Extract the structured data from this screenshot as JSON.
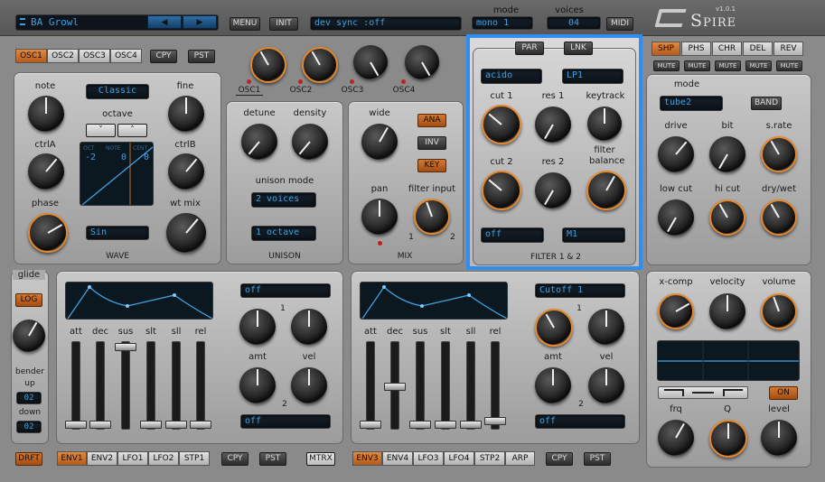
{
  "header": {
    "preset_name": "BA Growl",
    "prev_icon": "◀",
    "next_icon": "▶",
    "menu": "MENU",
    "init": "INIT",
    "fx_message": "dev sync :off",
    "mode_label": "mode",
    "mode_value": "mono 1",
    "voices_label": "voices",
    "voices_value": "04",
    "midi": "MIDI",
    "version": "v1.0.1",
    "logo": "Spire"
  },
  "osc": {
    "tabs": [
      "OSC1",
      "OSC2",
      "OSC3",
      "OSC4"
    ],
    "cpy": "CPY",
    "pst": "PST",
    "led_labels": [
      "OSC1",
      "OSC2",
      "OSC3",
      "OSC4"
    ],
    "note": "note",
    "fine": "fine",
    "wt_mode": "Classic",
    "octave": "octave",
    "oct_down": "˅",
    "oct_up": "˄",
    "ctrlA": "ctrlA",
    "ctrlB": "ctrlB",
    "phase": "phase",
    "wtmix": "wt mix",
    "readout_labels": [
      "OCT",
      "NOTE",
      "CENT"
    ],
    "readout_values": [
      "-2",
      "0",
      "0"
    ],
    "wave_select": "Sin",
    "wave_title": "WAVE"
  },
  "unison": {
    "detune": "detune",
    "density": "density",
    "mode_label": "unison mode",
    "mode_value": "2 voices",
    "octave_value": "1 octave",
    "title": "UNISON"
  },
  "mix": {
    "wide": "wide",
    "ana": "ANA",
    "inv": "INV",
    "key": "KEY",
    "pan": "pan",
    "filter_input": "filter input",
    "num1": "1",
    "num2": "2",
    "title": "MIX"
  },
  "filter": {
    "par": "PAR",
    "lnk": "LNK",
    "type1": "acido",
    "type2": "LP1",
    "cut1": "cut 1",
    "res1": "res 1",
    "keytrack": "keytrack",
    "cut2": "cut 2",
    "res2": "res 2",
    "balance": "filter balance",
    "mode1": "off",
    "mode2": "M1",
    "title": "FILTER 1 & 2",
    "highlight": "#2f8ef0"
  },
  "fx": {
    "tabs": [
      "SHP",
      "PHS",
      "CHR",
      "DEL",
      "REV"
    ],
    "mute": "MUTE",
    "mode_label": "mode",
    "mode_value": "tube2",
    "band": "BAND",
    "drive": "drive",
    "bit": "bit",
    "srate": "s.rate",
    "lowcut": "low cut",
    "hicut": "hi cut",
    "drywet": "dry/wet"
  },
  "master": {
    "xcomp": "x-comp",
    "velocity": "velocity",
    "volume": "volume",
    "on": "ON",
    "frq": "frq",
    "q": "Q",
    "level": "level"
  },
  "glide": {
    "title": "glide",
    "log": "LOG",
    "bender": "bender",
    "up": "up",
    "up_value": "02",
    "down": "down",
    "down_value": "02"
  },
  "env_left": {
    "labels": [
      "att",
      "dec",
      "sus",
      "slt",
      "sll",
      "rel"
    ],
    "dest_top": "off",
    "dest_bottom": "off",
    "amt": "amt",
    "vel": "vel",
    "n1": "1",
    "n2": "2"
  },
  "env_right": {
    "labels": [
      "att",
      "dec",
      "sus",
      "slt",
      "sll",
      "rel"
    ],
    "dest_top": "Cutoff 1",
    "dest_bottom": "off",
    "amt": "amt",
    "vel": "vel",
    "n1": "1",
    "n2": "2"
  },
  "bottom": {
    "drft": "DRFT",
    "left_tabs": [
      "ENV1",
      "ENV2",
      "LFO1",
      "LFO2",
      "STP1"
    ],
    "cpy": "CPY",
    "pst": "PST",
    "mtrx": "MTRX",
    "right_tabs": [
      "ENV3",
      "ENV4",
      "LFO3",
      "LFO4",
      "STP2",
      "ARP"
    ],
    "cpy2": "CPY",
    "pst2": "PST"
  },
  "colors": {
    "accent": "#e4862a",
    "lcd_text": "#3fa0e0",
    "highlight": "#2f8ef0"
  }
}
